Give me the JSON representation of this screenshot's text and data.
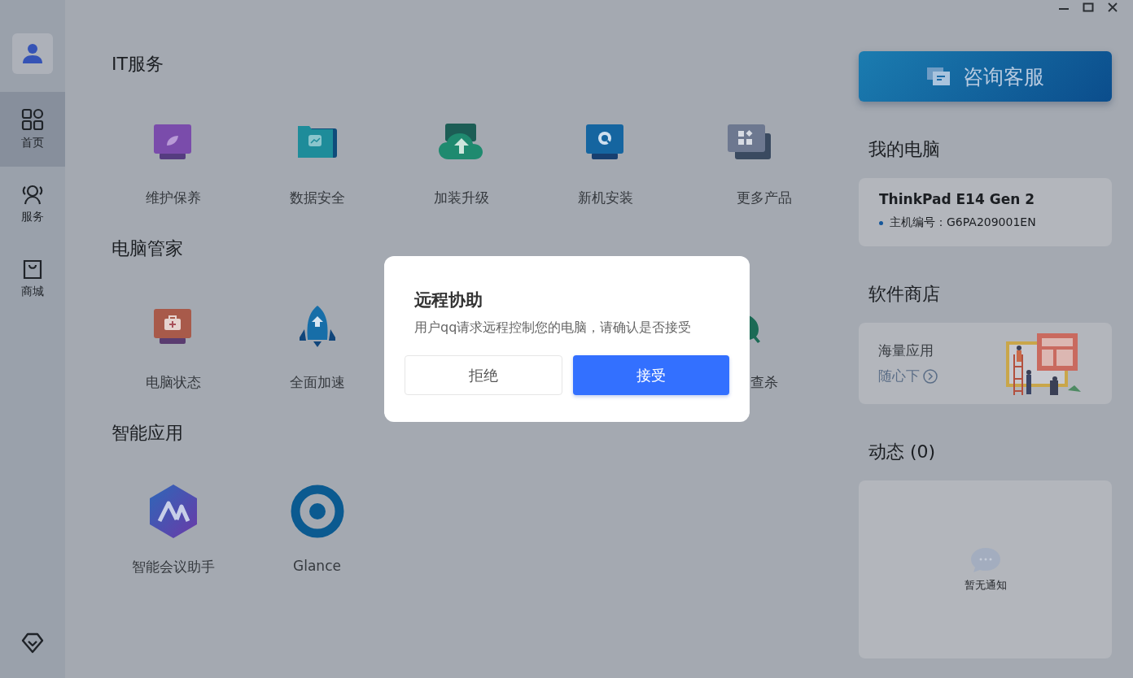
{
  "sidebar": {
    "items": [
      {
        "label": "首页",
        "kind": "grid",
        "selected": true
      },
      {
        "label": "服务",
        "kind": "people",
        "selected": false
      },
      {
        "label": "商城",
        "kind": "bag",
        "selected": false
      }
    ]
  },
  "sections": [
    {
      "title": "IT服务",
      "items": [
        {
          "label": "维护保养",
          "kind": "leaf-monitor"
        },
        {
          "label": "数据安全",
          "kind": "chart-folder"
        },
        {
          "label": "加装升级",
          "kind": "upload-cloud"
        },
        {
          "label": "新机安装",
          "kind": "search-monitor"
        },
        {
          "label": "更多产品",
          "kind": "apps-stack"
        }
      ]
    },
    {
      "title": "电脑管家",
      "items": [
        {
          "label": "电脑状态",
          "kind": "medkit-monitor"
        },
        {
          "label": "全面加速",
          "kind": "rocket"
        },
        {
          "kind": "hidden"
        },
        {
          "kind": "hidden"
        },
        {
          "label": "查杀",
          "kind": "magnifier-bubble"
        }
      ]
    },
    {
      "title": "智能应用",
      "items": [
        {
          "label": "智能会议助手",
          "kind": "hexagon-logo"
        },
        {
          "label": "Glance",
          "kind": "ring-logo"
        }
      ]
    }
  ],
  "right_panel": {
    "consult_button": "咨询客服",
    "my_pc": {
      "title": "我的电脑",
      "model": "ThinkPad E14 Gen 2",
      "serial": "主机编号：G6PA209001EN"
    },
    "store": {
      "title": "软件商店",
      "headline": "海量应用",
      "link": "随心下"
    },
    "news": {
      "title": "动态 (0)",
      "empty": "暂无通知"
    }
  },
  "dialog": {
    "title": "远程协助",
    "message": "用户qq请求远程控制您的电脑，请确认是否接受",
    "buttons": [
      {
        "label": "拒绝",
        "kind": "secondary"
      },
      {
        "label": "接受",
        "kind": "primary"
      }
    ]
  }
}
